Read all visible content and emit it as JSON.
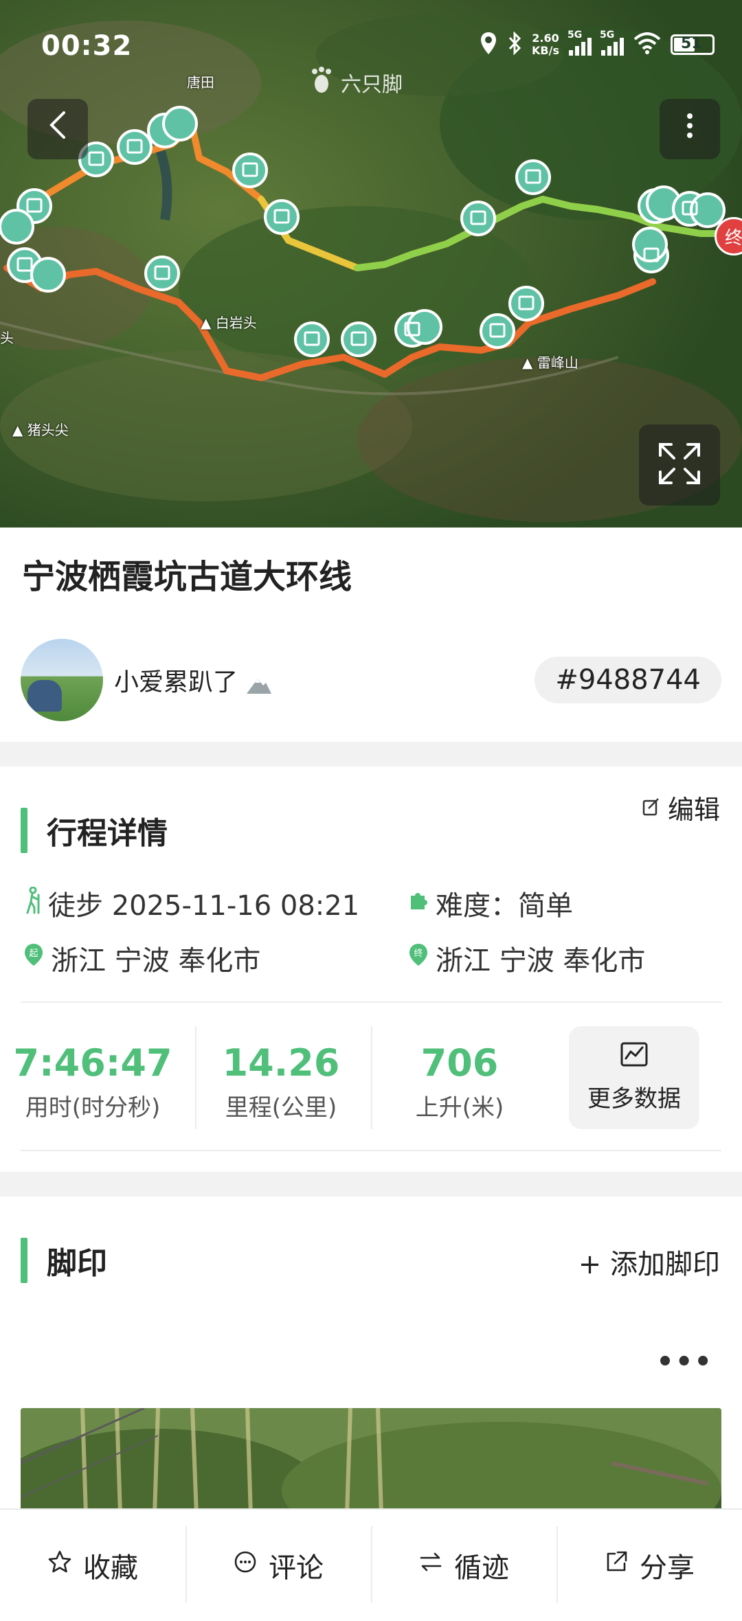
{
  "status_bar": {
    "time": "00:32",
    "net_speed": "2.60",
    "net_unit": "KB/s",
    "sig1_label": "5G",
    "sig2_label": "5G",
    "battery": "51"
  },
  "map": {
    "watermark": "六只脚",
    "places": [
      "唐田",
      "白岩头",
      "雷峰山",
      "猪头尖",
      "头"
    ],
    "end_marker": "终"
  },
  "route": {
    "title": "宁波栖霞坑古道大环线"
  },
  "author": {
    "name": "小爱累趴了",
    "route_id": "#9488744"
  },
  "trip": {
    "section_title": "行程详情",
    "edit_label": "编辑",
    "activity": "徒步 2025-11-16 08:21",
    "difficulty": "难度：简单",
    "start_badge": "起",
    "end_badge": "终",
    "start_location": "浙江 宁波 奉化市",
    "end_location": "浙江 宁波 奉化市"
  },
  "stats": [
    {
      "value": "7:46:47",
      "label": "用时(时分秒)"
    },
    {
      "value": "14.26",
      "label": "里程(公里)"
    },
    {
      "value": "706",
      "label": "上升(米)"
    }
  ],
  "more_data_label": "更多数据",
  "footprints": {
    "section_title": "脚印",
    "add_label": "+ 添加脚印",
    "more_label": "•••"
  },
  "bottom_tabs": [
    {
      "label": "收藏",
      "icon": "star-icon"
    },
    {
      "label": "评论",
      "icon": "comment-icon"
    },
    {
      "label": "循迹",
      "icon": "route-icon"
    },
    {
      "label": "分享",
      "icon": "share-icon"
    }
  ],
  "colors": {
    "accent": "#4fbf7a",
    "route_orange": "#f08a2c",
    "route_yellow": "#e8c53a",
    "route_green": "#8fd04a",
    "end_red": "#e04040"
  }
}
